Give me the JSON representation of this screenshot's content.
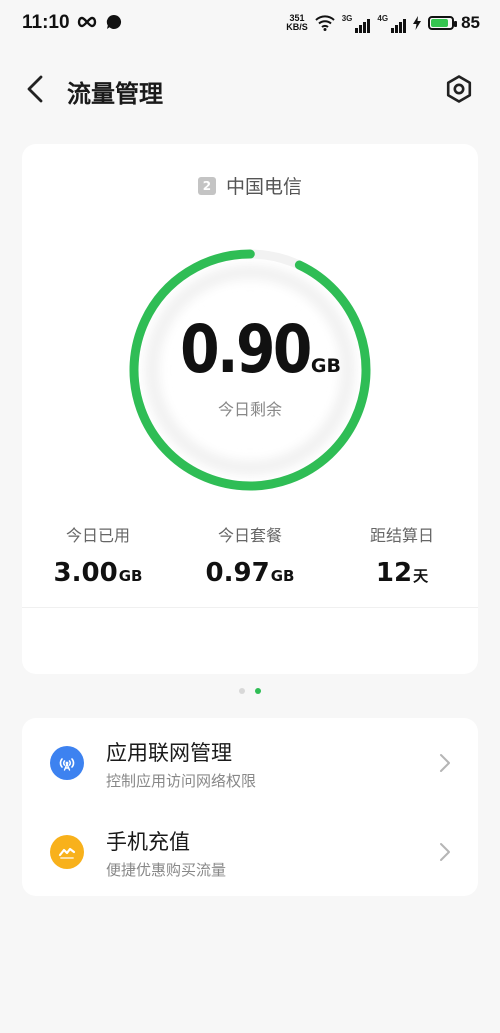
{
  "status": {
    "time": "11:10",
    "speed_value": "351",
    "speed_unit": "KB/S",
    "net1_label": "3G",
    "net2_label": "4G",
    "battery_pct": "85",
    "battery_level": 0.85
  },
  "header": {
    "title": "流量管理"
  },
  "card": {
    "sim_number": "2",
    "carrier": "中国电信",
    "remaining_value": "0.90",
    "remaining_unit": "GB",
    "remaining_label": "今日剩余",
    "ring_fraction": 0.93,
    "ring_color": "#2fbd55",
    "stats": [
      {
        "label": "今日已用",
        "value": "3.00",
        "unit": "GB"
      },
      {
        "label": "今日套餐",
        "value": "0.97",
        "unit": "GB"
      },
      {
        "label": "距结算日",
        "value": "12",
        "unit": "天"
      }
    ]
  },
  "list": {
    "items": [
      {
        "title": "应用联网管理",
        "subtitle": "控制应用访问网络权限",
        "icon": "network-tower-icon",
        "color": "#3d82f0"
      },
      {
        "title": "手机充值",
        "subtitle": "便捷优惠购买流量",
        "icon": "recharge-icon",
        "color": "#f8b11b"
      }
    ]
  }
}
